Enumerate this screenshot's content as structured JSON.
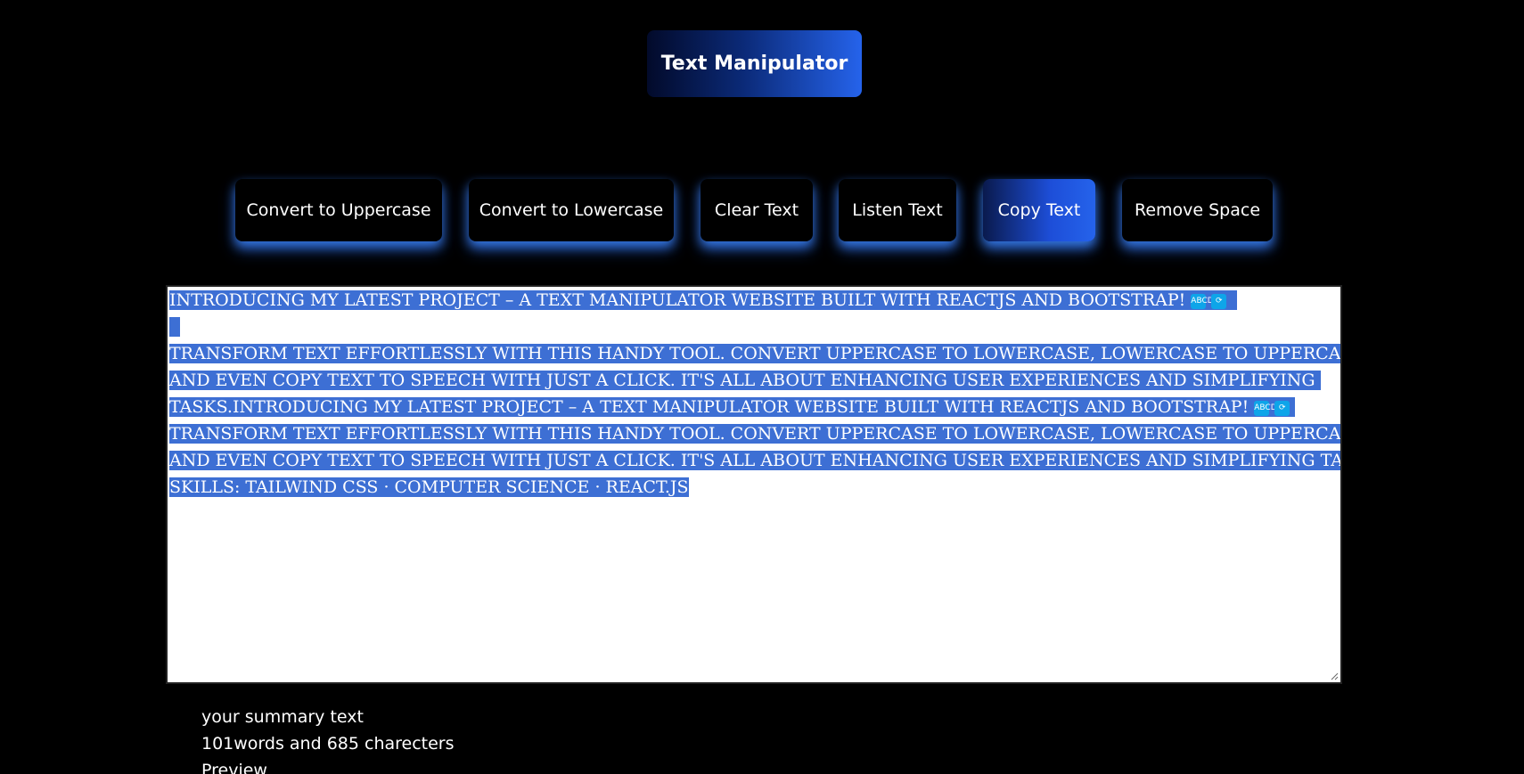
{
  "header": {
    "title": "Text Manipulator"
  },
  "toolbar": {
    "buttons": [
      {
        "label": "Convert to Uppercase"
      },
      {
        "label": "Convert to Lowercase"
      },
      {
        "label": "Clear Text"
      },
      {
        "label": "Listen Text"
      },
      {
        "label": "Copy Text"
      },
      {
        "label": "Remove Space"
      }
    ],
    "active_button": "Copy Text"
  },
  "editor": {
    "lines": [
      " INTRODUCING MY LATEST PROJECT – A TEXT MANIPULATOR WEBSITE BUILT WITH REACTJS AND BOOTSTRAP!",
      "TRANSFORM TEXT EFFORTLESSLY WITH THIS HANDY TOOL. CONVERT UPPERCASE TO LOWERCASE, LOWERCASE TO UPPERCASE,",
      "AND EVEN COPY TEXT TO SPEECH WITH JUST A CLICK. IT'S ALL ABOUT ENHANCING USER EXPERIENCES AND SIMPLIFYING",
      "TASKS.INTRODUCING MY LATEST PROJECT – A TEXT MANIPULATOR WEBSITE BUILT WITH REACTJS AND BOOTSTRAP!",
      "TRANSFORM TEXT EFFORTLESSLY WITH THIS HANDY TOOL. CONVERT UPPERCASE TO LOWERCASE, LOWERCASE TO UPPERCASE,",
      "AND EVEN COPY TEXT TO SPEECH WITH JUST A CLICK. IT'S ALL ABOUT ENHANCING USER EXPERIENCES AND SIMPLIFYING TASKS.",
      "SKILLS: TAILWIND CSS · COMPUTER SCIENCE · REACT.JS"
    ],
    "icons": {
      "abcd_icon": "ABCD",
      "arrows_icon": "⟳"
    },
    "selection_color": "#3d6fd4"
  },
  "summary": {
    "heading": "your summary text",
    "counts": "101words and 685 charecters",
    "preview_label": "Preview"
  },
  "colors": {
    "background": "#000000",
    "accent": "#2563eb",
    "button_glow": "#3b82f6"
  }
}
